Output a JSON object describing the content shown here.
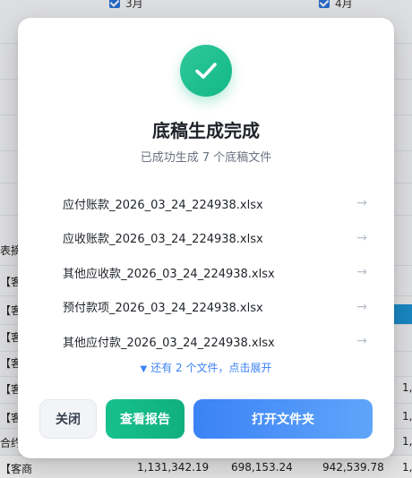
{
  "background": {
    "months": [
      "3月",
      "4月"
    ],
    "row_labels": [
      "表摘",
      "【客",
      "【客",
      "【客商",
      "【客",
      "【客商",
      "【客",
      "合约",
      "【客商"
    ],
    "last_row_values": [
      "1,131,342.19",
      "698,153.24",
      "942,539.78"
    ],
    "right_edge_values": [
      "1,",
      "1,",
      "1,",
      "1,"
    ]
  },
  "modal": {
    "title": "底稿生成完成",
    "subtitle": "已成功生成 7 个底稿文件",
    "files": [
      "应付账款_2026_03_24_224938.xlsx",
      "应收账款_2026_03_24_224938.xlsx",
      "其他应收款_2026_03_24_224938.xlsx",
      "预付款项_2026_03_24_224938.xlsx",
      "其他应付款_2026_03_24_224938.xlsx"
    ],
    "arrow_glyph": "→",
    "expand_triangle": "▼",
    "expand_label": "还有 2 个文件，点击展开",
    "buttons": {
      "close": "关闭",
      "report": "查看报告",
      "open_folder": "打开文件夹"
    },
    "colors": {
      "success": "#12b886",
      "primary": "#3b82f6",
      "link": "#3b82f6"
    }
  }
}
